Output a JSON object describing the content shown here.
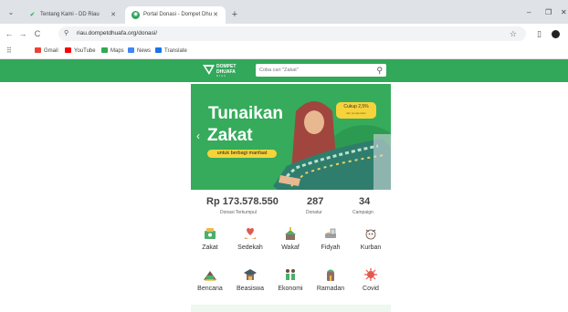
{
  "browser": {
    "tabs": [
      {
        "title": "Tentang Kami - DD Riau",
        "close": "✕"
      },
      {
        "title": "Portal Donasi - Dompet Dhuafa",
        "close": "✕"
      }
    ],
    "new_tab": "+",
    "window_controls": {
      "minimize": "–",
      "restore": "❐",
      "close": "✕"
    },
    "nav": {
      "back": "←",
      "forward": "→",
      "reload": "C"
    },
    "url": "riau.dompetdhuafa.org/donasi/",
    "bookmarks": [
      {
        "label": "Gmail",
        "color": "#ea4335"
      },
      {
        "label": "YouTube",
        "color": "#ff0000"
      },
      {
        "label": "Maps",
        "color": "#34a853"
      },
      {
        "label": "News",
        "color": "#4285f4"
      },
      {
        "label": "Translate",
        "color": "#1a73e8"
      }
    ]
  },
  "site": {
    "brand_color": "#32a85a",
    "logo": {
      "line1": "DOMPET",
      "line2": "DHUAFA",
      "line3": "RIAU"
    },
    "search_placeholder": "Coba cari \"Zakat\"",
    "banner": {
      "title1": "Tunaikan",
      "title2": "Zakat",
      "pill": "untuk berbagi manfaat",
      "badge": "Cukup 2,5%",
      "badge_small": "dari penghasilan",
      "prev": "‹"
    },
    "stats": {
      "collected_value": "Rp 173.578.550",
      "collected_label": "Donasi Terkumpul",
      "donors_value": "287",
      "donors_label": "Donatur",
      "campaigns_value": "34",
      "campaigns_label": "Campaign"
    },
    "categories": [
      {
        "label": "Zakat",
        "icon": "zakat-icon"
      },
      {
        "label": "Sedekah",
        "icon": "sedekah-icon"
      },
      {
        "label": "Wakaf",
        "icon": "wakaf-icon"
      },
      {
        "label": "Fidyah",
        "icon": "fidyah-icon"
      },
      {
        "label": "Kurban",
        "icon": "kurban-icon"
      },
      {
        "label": "Bencana",
        "icon": "bencana-icon"
      },
      {
        "label": "Beasiswa",
        "icon": "beasiswa-icon"
      },
      {
        "label": "Ekonomi",
        "icon": "ekonomi-icon"
      },
      {
        "label": "Ramadan",
        "icon": "ramadan-icon"
      },
      {
        "label": "Covid",
        "icon": "covid-icon"
      }
    ]
  }
}
